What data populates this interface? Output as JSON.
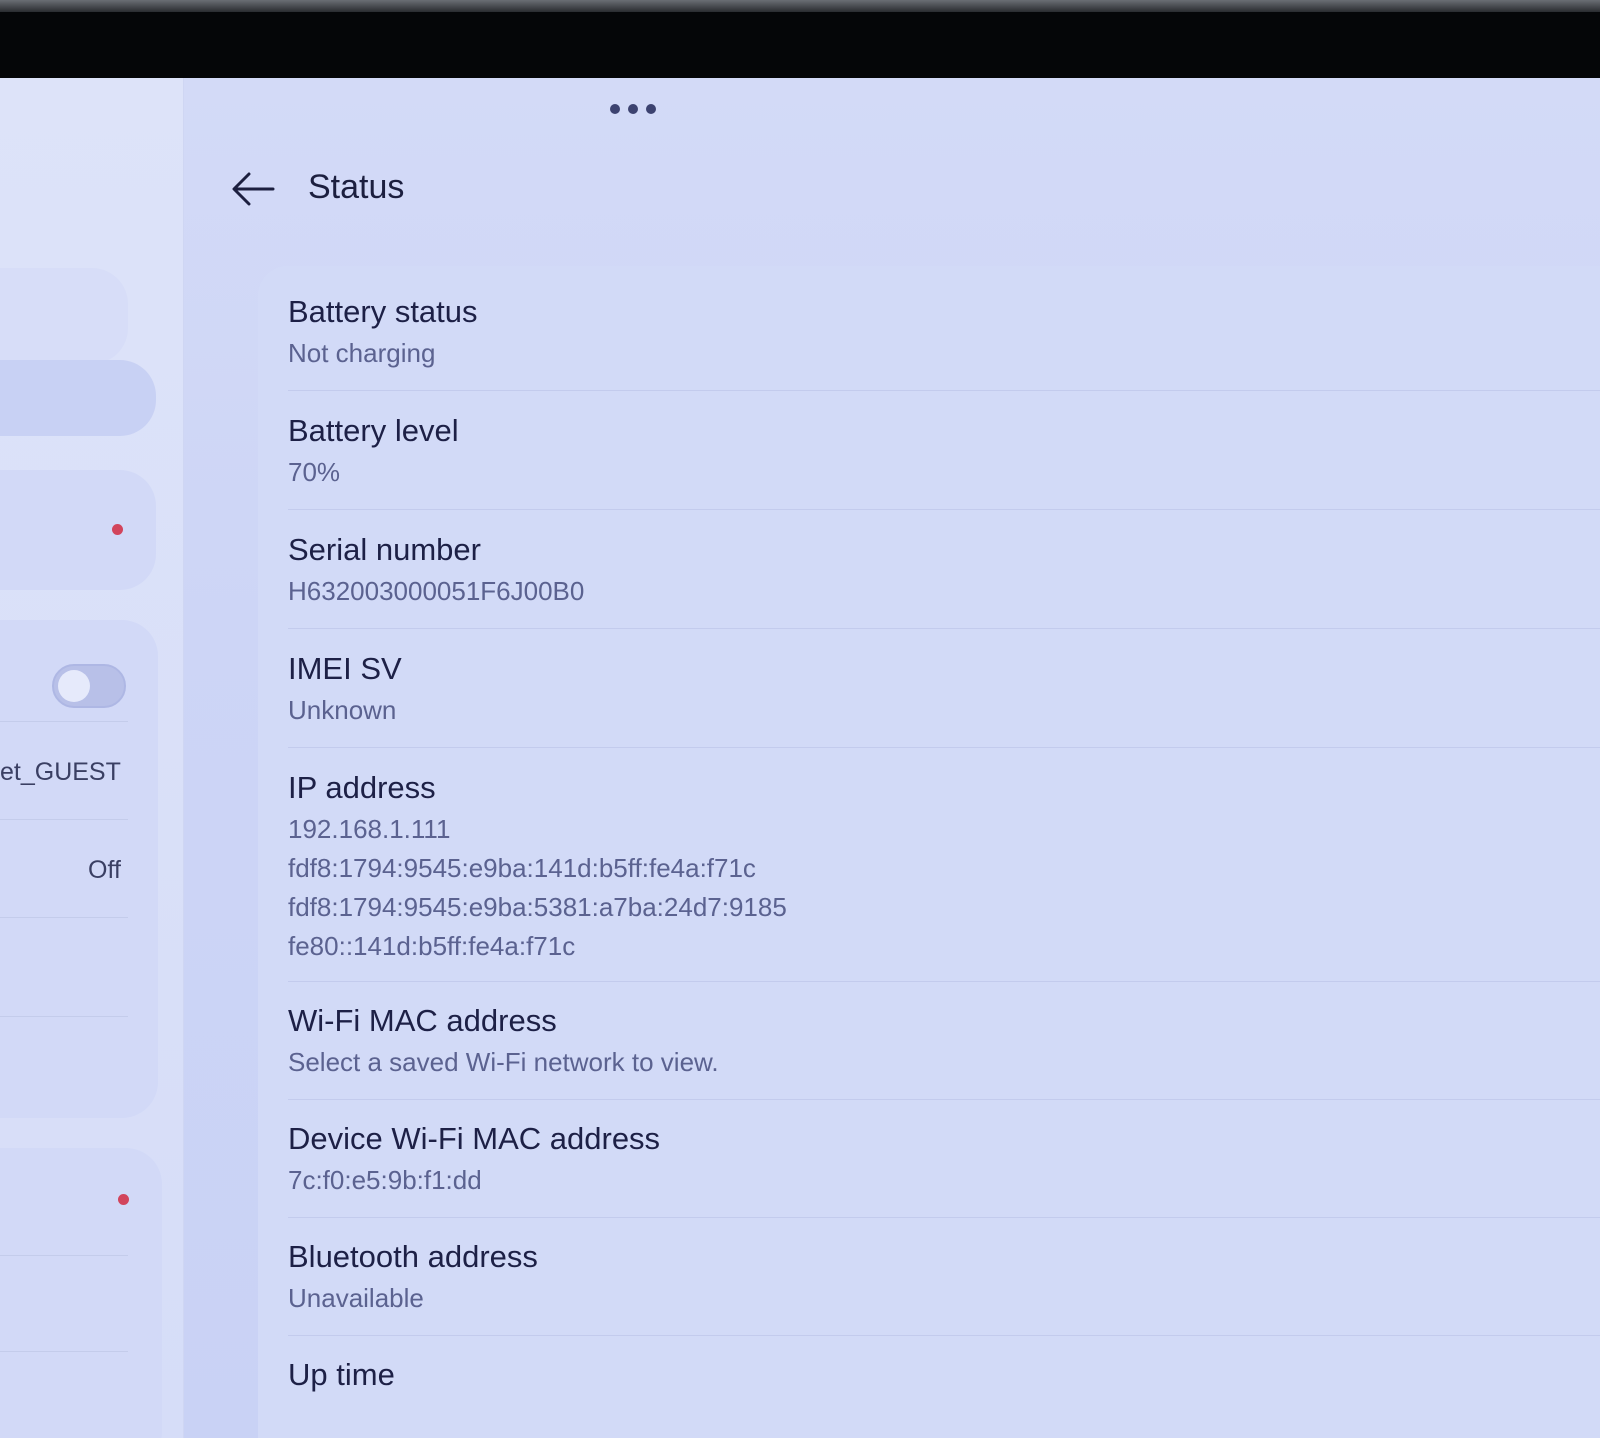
{
  "header": {
    "title": "Status",
    "back_icon": "arrow-left-icon",
    "menu_icon": "more-dots-icon"
  },
  "left_pane": {
    "network_name_fragment": "et_GUEST",
    "off_label": "Off",
    "badge_color": "#d2445c"
  },
  "items": [
    {
      "title": "Battery status",
      "values": [
        "Not charging"
      ]
    },
    {
      "title": "Battery level",
      "values": [
        "70%"
      ]
    },
    {
      "title": "Serial number",
      "values": [
        "H632003000051F6J00B0"
      ]
    },
    {
      "title": "IMEI SV",
      "values": [
        "Unknown"
      ]
    },
    {
      "title": "IP address",
      "values": [
        "192.168.1.111",
        "fdf8:1794:9545:e9ba:141d:b5ff:fe4a:f71c",
        "fdf8:1794:9545:e9ba:5381:a7ba:24d7:9185",
        "fe80::141d:b5ff:fe4a:f71c"
      ]
    },
    {
      "title": "Wi-Fi MAC address",
      "values": [
        "Select a saved Wi-Fi network to view."
      ]
    },
    {
      "title": "Device Wi-Fi MAC address",
      "values": [
        "7c:f0:e5:9b:f1:dd"
      ]
    },
    {
      "title": "Bluetooth address",
      "values": [
        "Unavailable"
      ]
    },
    {
      "title": "Up time",
      "values": []
    }
  ]
}
